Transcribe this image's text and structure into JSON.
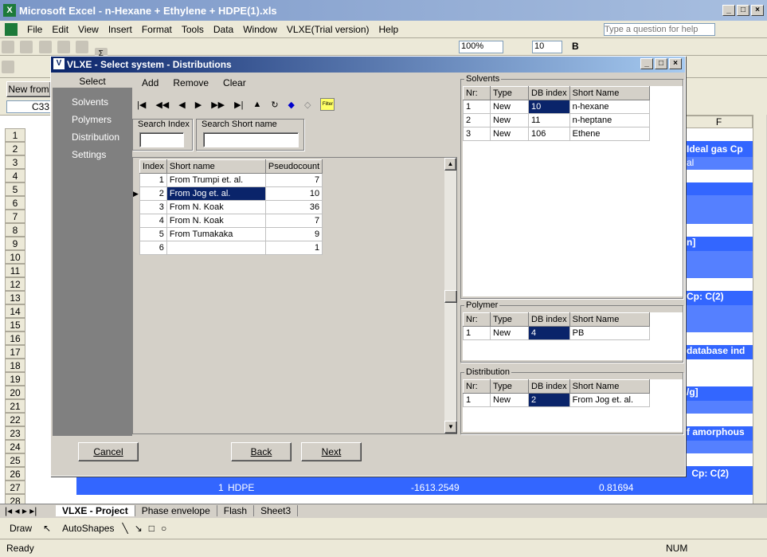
{
  "excel": {
    "title": "Microsoft Excel - n-Hexane + Ethylene + HDPE(1).xls",
    "menu": [
      "File",
      "Edit",
      "View",
      "Insert",
      "Format",
      "Tools",
      "Data",
      "Window",
      "VLXE(Trial version)",
      "Help"
    ],
    "help_placeholder": "Type a question for help",
    "zoom": "100%",
    "font_size": "10",
    "name_box": "C33",
    "new_from": "New from",
    "col_f": "F",
    "rows": [
      "1",
      "2",
      "3",
      "4",
      "5",
      "6",
      "7",
      "8",
      "9",
      "10",
      "11",
      "12",
      "13",
      "14",
      "15",
      "16",
      "17",
      "18",
      "19",
      "20",
      "21",
      "22",
      "23",
      "24",
      "25",
      "26",
      "27",
      "28"
    ],
    "right_labels": [
      "Ideal gas Cp",
      "al",
      "n]",
      "Cp: C(2)",
      "database ind",
      "/g]",
      "f amorphous",
      "Cp: C(2)"
    ],
    "row27": {
      "index": "1",
      "name": "HDPE",
      "value1": "-1613.2549",
      "value2": "0.81694"
    },
    "sheet_tabs": [
      "VLXE - Project",
      "Phase envelope",
      "Flash",
      "Sheet3"
    ],
    "draw_label": "Draw",
    "autoshapes_label": "AutoShapes",
    "status": "Ready",
    "num": "NUM"
  },
  "dialog": {
    "title": "VLXE - Select system  -  Distributions",
    "left_header": "Select",
    "left_items": [
      "Solvents",
      "Polymers",
      "Distribution",
      "Settings"
    ],
    "actions": [
      "Add",
      "Remove",
      "Clear"
    ],
    "search_index_label": "Search Index",
    "search_short_label": "Search Short name",
    "search_index_value": "",
    "search_short_value": "",
    "dist_table": {
      "headers": [
        "Index",
        "Short name",
        "Pseudocount"
      ],
      "rows": [
        [
          "1",
          "From Trumpi et. al.",
          "7"
        ],
        [
          "2",
          "From Jog et. al.",
          "10"
        ],
        [
          "3",
          "From N. Koak",
          "36"
        ],
        [
          "4",
          "From N. Koak",
          "7"
        ],
        [
          "5",
          "From Tumakaka",
          "9"
        ],
        [
          "6",
          "",
          "1"
        ]
      ]
    },
    "solvents": {
      "label": "Solvents",
      "headers": [
        "Nr:",
        "Type",
        "DB index",
        "Short Name"
      ],
      "rows": [
        [
          "1",
          "New",
          "10",
          "n-hexane"
        ],
        [
          "2",
          "New",
          "11",
          "n-heptane"
        ],
        [
          "3",
          "New",
          "106",
          "Ethene"
        ]
      ]
    },
    "polymer": {
      "label": "Polymer",
      "headers": [
        "Nr:",
        "Type",
        "DB index",
        "Short Name"
      ],
      "rows": [
        [
          "1",
          "New",
          "4",
          "PB"
        ]
      ]
    },
    "distribution": {
      "label": "Distribution",
      "headers": [
        "Nr:",
        "Type",
        "DB index",
        "Short Name"
      ],
      "rows": [
        [
          "1",
          "New",
          "2",
          "From Jog et. al."
        ]
      ]
    },
    "buttons": {
      "cancel": "Cancel",
      "back": "Back",
      "next": "Next"
    }
  }
}
